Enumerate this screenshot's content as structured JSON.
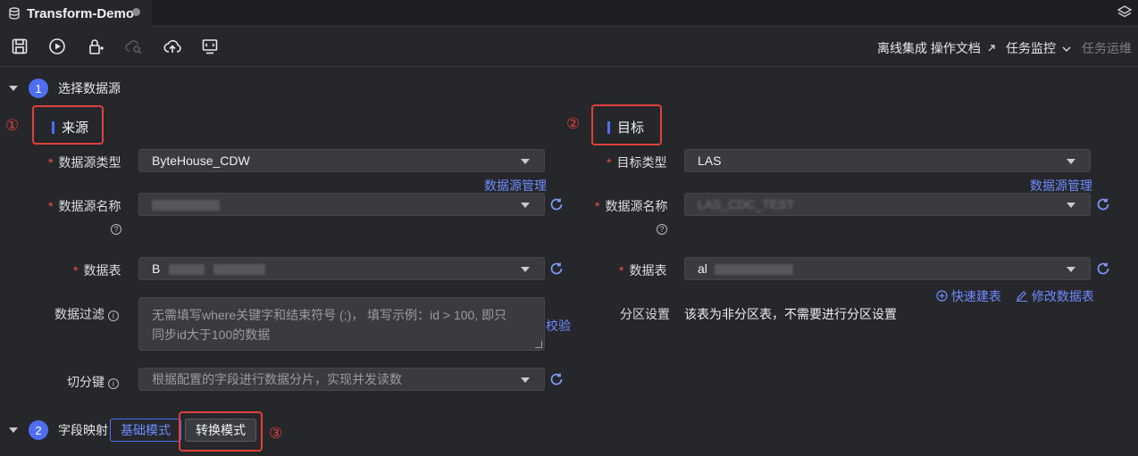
{
  "tab": {
    "title": "Transform-Demo"
  },
  "toolbar": {
    "docs_link": "离线集成 操作文档",
    "monitor": "任务监控",
    "ops": "任务运维"
  },
  "section1": {
    "step": "1",
    "title": "选择数据源"
  },
  "section2": {
    "step": "2",
    "title": "字段映射",
    "mode_basic": "基础模式",
    "mode_transform": "转换模式"
  },
  "annotations": {
    "n1": "①",
    "n2": "②",
    "n3": "③"
  },
  "source": {
    "heading": "来源",
    "type_label": "数据源类型",
    "type_value": "ByteHouse_CDW",
    "manage_link": "数据源管理",
    "name_label": "数据源名称",
    "table_label": "数据表",
    "table_value_prefix": "B",
    "filter_label": "数据过滤",
    "filter_placeholder_line1": "无需填写where关键字和结束符号 (;)， 填写示例：id > 100, 即只",
    "filter_placeholder_line2": "同步id大于100的数据",
    "validate_link": "校验",
    "split_label": "切分键",
    "split_placeholder": "根据配置的字段进行数据分片，实现并发读数"
  },
  "target": {
    "heading": "目标",
    "type_label": "目标类型",
    "type_value": "LAS",
    "manage_link": "数据源管理",
    "name_label": "数据源名称",
    "name_value_prefix": "LAS_CDC_TEST",
    "table_label": "数据表",
    "table_value_prefix": "al",
    "quick_create": "快速建表",
    "edit_table": "修改数据表",
    "partition_label": "分区设置",
    "partition_value": "该表为非分区表，不需要进行分区设置"
  },
  "colors": {
    "accent": "#4e6ef2",
    "link": "#6e8cff",
    "annotation_red": "#e0413a",
    "required": "#f0524a"
  }
}
